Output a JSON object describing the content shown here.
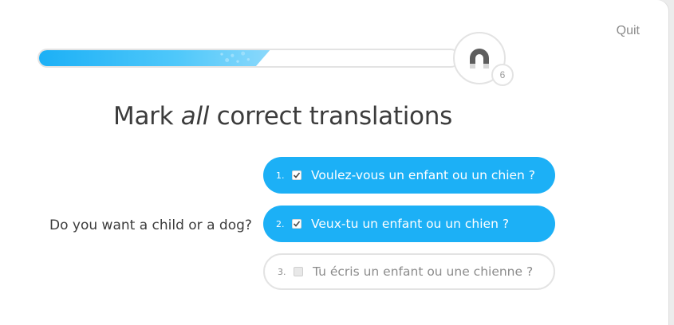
{
  "header": {
    "quit_label": "Quit"
  },
  "progress": {
    "fraction_complete": 0.55,
    "badge_count": "6"
  },
  "prompt": {
    "title_before": "Mark ",
    "title_emphasis": "all",
    "title_after": " correct translations",
    "source_sentence": "Do you want a child or a dog?"
  },
  "options": [
    {
      "number": "1.",
      "text": "Voulez-vous un enfant ou un chien ?",
      "checked": true
    },
    {
      "number": "2.",
      "text": "Veux-tu un enfant ou un chien ?",
      "checked": true
    },
    {
      "number": "3.",
      "text": "Tu écris un enfant ou une chienne ?",
      "checked": false
    }
  ],
  "colors": {
    "accent": "#1cb0f6",
    "border": "#e3e3e3",
    "text": "#3c3c3c",
    "muted": "#8b8b8b"
  },
  "icons": {
    "badge": "magnet-icon",
    "checkbox_checked": "checkbox-checked-icon",
    "checkbox_unchecked": "checkbox-unchecked-icon"
  }
}
